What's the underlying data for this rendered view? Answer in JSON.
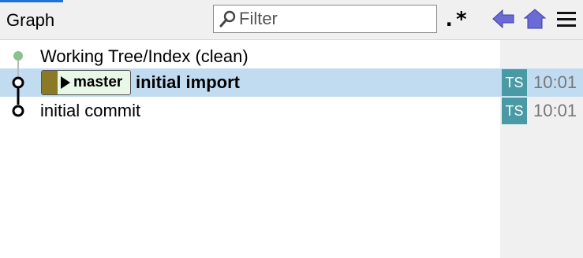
{
  "header": {
    "title": "Graph",
    "filter_placeholder": "Filter",
    "regex_label": ".*",
    "back_icon": "back-arrow-icon",
    "home_icon": "home-icon",
    "menu_icon": "hamburger-menu-icon",
    "accent_color": "#1e73d7",
    "nav_icon_color": "#6b6bd6"
  },
  "graph": {
    "rows": [
      {
        "message": "Working Tree/Index (clean)",
        "node_color": "#8cc08c",
        "selected": false
      },
      {
        "message": "initial import",
        "branch": "master",
        "author_initials": "TS",
        "time": "10:01",
        "selected": true
      },
      {
        "message": "initial commit",
        "author_initials": "TS",
        "time": "10:01",
        "selected": false
      }
    ]
  },
  "colors": {
    "selection": "#c1dcf1",
    "avatar": "#4a9aa6",
    "branch_swatch": "#8a7a28",
    "branch_tag_bg": "#e9f7e9"
  }
}
